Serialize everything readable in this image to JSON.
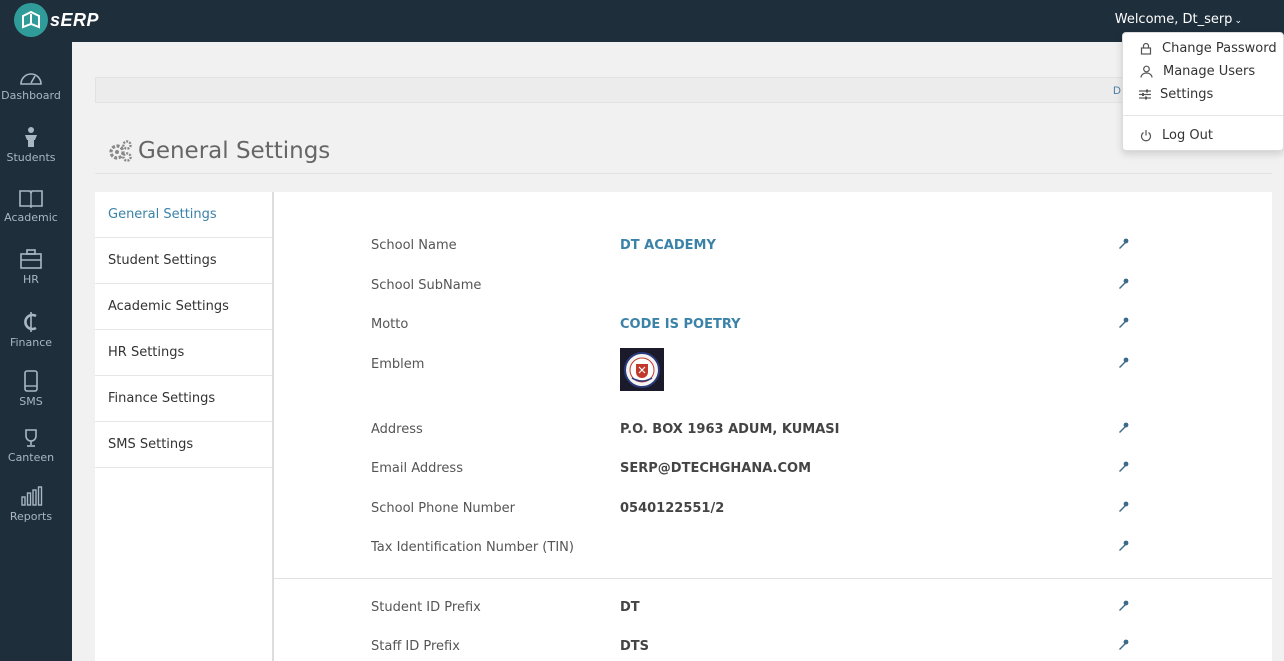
{
  "app": {
    "logo_text": "sERP"
  },
  "header": {
    "welcome": "Welcome, Dt_serp",
    "caret": "⌄"
  },
  "sidebar": {
    "items": [
      {
        "label": "Dashboard",
        "icon": "dashboard-icon"
      },
      {
        "label": "Students",
        "icon": "student-icon"
      },
      {
        "label": "Academic",
        "icon": "book-icon"
      },
      {
        "label": "HR",
        "icon": "briefcase-icon"
      },
      {
        "label": "Finance",
        "icon": "cedi-icon"
      },
      {
        "label": "SMS",
        "icon": "phone-icon"
      },
      {
        "label": "Canteen",
        "icon": "trophy-icon"
      },
      {
        "label": "Reports",
        "icon": "bar-chart-icon"
      }
    ]
  },
  "breadcrumb": {
    "text": "D"
  },
  "page": {
    "title": "General Settings"
  },
  "tabs": [
    {
      "label": "General Settings",
      "active": true
    },
    {
      "label": "Student Settings"
    },
    {
      "label": "Academic Settings"
    },
    {
      "label": "HR Settings"
    },
    {
      "label": "Finance Settings"
    },
    {
      "label": "SMS Settings"
    }
  ],
  "settings": {
    "school_name": {
      "label": "School Name",
      "value": "DT ACADEMY"
    },
    "school_subname": {
      "label": "School SubName",
      "value": ""
    },
    "motto": {
      "label": "Motto",
      "value": "CODE IS POETRY"
    },
    "emblem": {
      "label": "Emblem"
    },
    "address": {
      "label": "Address",
      "value": "P.O. BOX 1963 ADUM, KUMASI"
    },
    "email": {
      "label": "Email Address",
      "value": "SERP@DTECHGHANA.COM"
    },
    "phone": {
      "label": "School Phone Number",
      "value": "0540122551/2"
    },
    "tin": {
      "label": "Tax Identification Number (TIN)",
      "value": ""
    },
    "student_prefix": {
      "label": "Student ID Prefix",
      "value": "DT"
    },
    "staff_prefix": {
      "label": "Staff ID Prefix",
      "value": "DTS"
    }
  },
  "user_menu": {
    "change_password": "Change Password",
    "manage_users": "Manage Users",
    "settings": "Settings",
    "logout": "Log Out"
  },
  "colors": {
    "topbar": "#1f2e3b",
    "accent": "#3b82a8",
    "logo": "#2f9c9a"
  }
}
